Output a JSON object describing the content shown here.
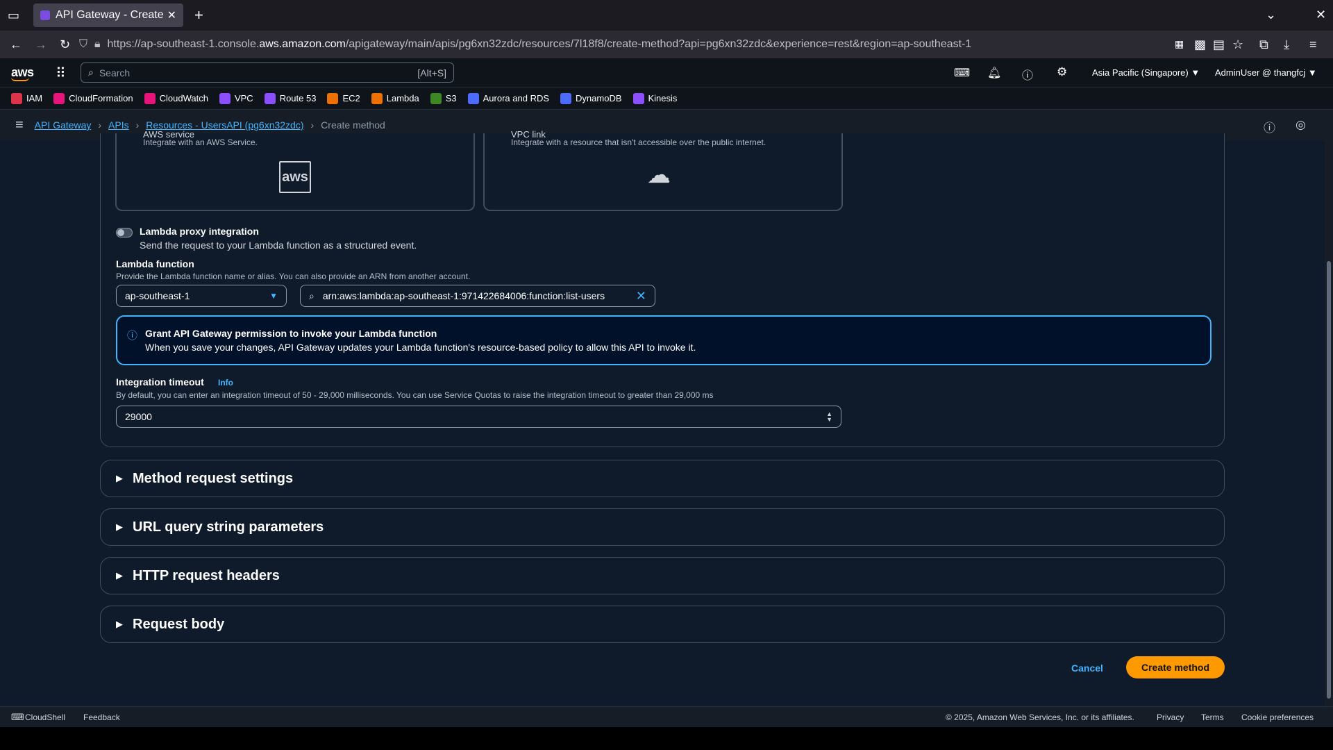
{
  "browser": {
    "tab_title": "API Gateway - Create m",
    "new_tab": "+",
    "url_prefix": "https://ap-southeast-1.console.",
    "url_host": "aws.amazon.com",
    "url_path": "/apigateway/main/apis/pg6xn32zdc/resources/7l18f8/create-method?api=pg6xn32zdc&experience=rest&region=ap-southeast-1"
  },
  "aws_nav": {
    "logo": "aws",
    "search_placeholder": "Search",
    "search_shortcut": "[Alt+S]",
    "region": "Asia Pacific (Singapore) ▼",
    "user": "AdminUser @ thangfcj ▼"
  },
  "favorites": [
    {
      "label": "IAM",
      "color": "#dd344c"
    },
    {
      "label": "CloudFormation",
      "color": "#e7157b"
    },
    {
      "label": "CloudWatch",
      "color": "#e7157b"
    },
    {
      "label": "VPC",
      "color": "#8c4fff"
    },
    {
      "label": "Route 53",
      "color": "#8c4fff"
    },
    {
      "label": "EC2",
      "color": "#ed7100"
    },
    {
      "label": "Lambda",
      "color": "#ed7100"
    },
    {
      "label": "S3",
      "color": "#3f8624"
    },
    {
      "label": "Aurora and RDS",
      "color": "#4d6bfe"
    },
    {
      "label": "DynamoDB",
      "color": "#4d6bfe"
    },
    {
      "label": "Kinesis",
      "color": "#8c4fff"
    }
  ],
  "breadcrumb": {
    "items": [
      "API Gateway",
      "APIs",
      "Resources - UsersAPI (pg6xn32zdc)"
    ],
    "current": "Create method"
  },
  "integration_tiles": {
    "aws_service": {
      "title": "AWS service",
      "desc": "Integrate with an AWS Service.",
      "icon_text": "aws"
    },
    "vpc_link": {
      "title": "VPC link",
      "desc": "Integrate with a resource that isn't accessible over the public internet."
    }
  },
  "lambda_proxy": {
    "label": "Lambda proxy integration",
    "desc": "Send the request to your Lambda function as a structured event."
  },
  "lambda_function": {
    "label": "Lambda function",
    "desc": "Provide the Lambda function name or alias. You can also provide an ARN from another account.",
    "region_value": "ap-southeast-1",
    "arn_value": "arn:aws:lambda:ap-southeast-1:971422684006:function:list-users"
  },
  "alert": {
    "title": "Grant API Gateway permission to invoke your Lambda function",
    "body": "When you save your changes, API Gateway updates your Lambda function's resource-based policy to allow this API to invoke it."
  },
  "timeout": {
    "label": "Integration timeout",
    "info": "Info",
    "desc": "By default, you can enter an integration timeout of 50 - 29,000 milliseconds. You can use Service Quotas to raise the integration timeout to greater than 29,000 ms",
    "value": "29000"
  },
  "sections": [
    "Method request settings",
    "URL query string parameters",
    "HTTP request headers",
    "Request body"
  ],
  "actions": {
    "cancel": "Cancel",
    "create": "Create method"
  },
  "footer": {
    "cloudshell": "CloudShell",
    "feedback": "Feedback",
    "copyright": "© 2025, Amazon Web Services, Inc. or its affiliates.",
    "privacy": "Privacy",
    "terms": "Terms",
    "cookies": "Cookie preferences"
  }
}
